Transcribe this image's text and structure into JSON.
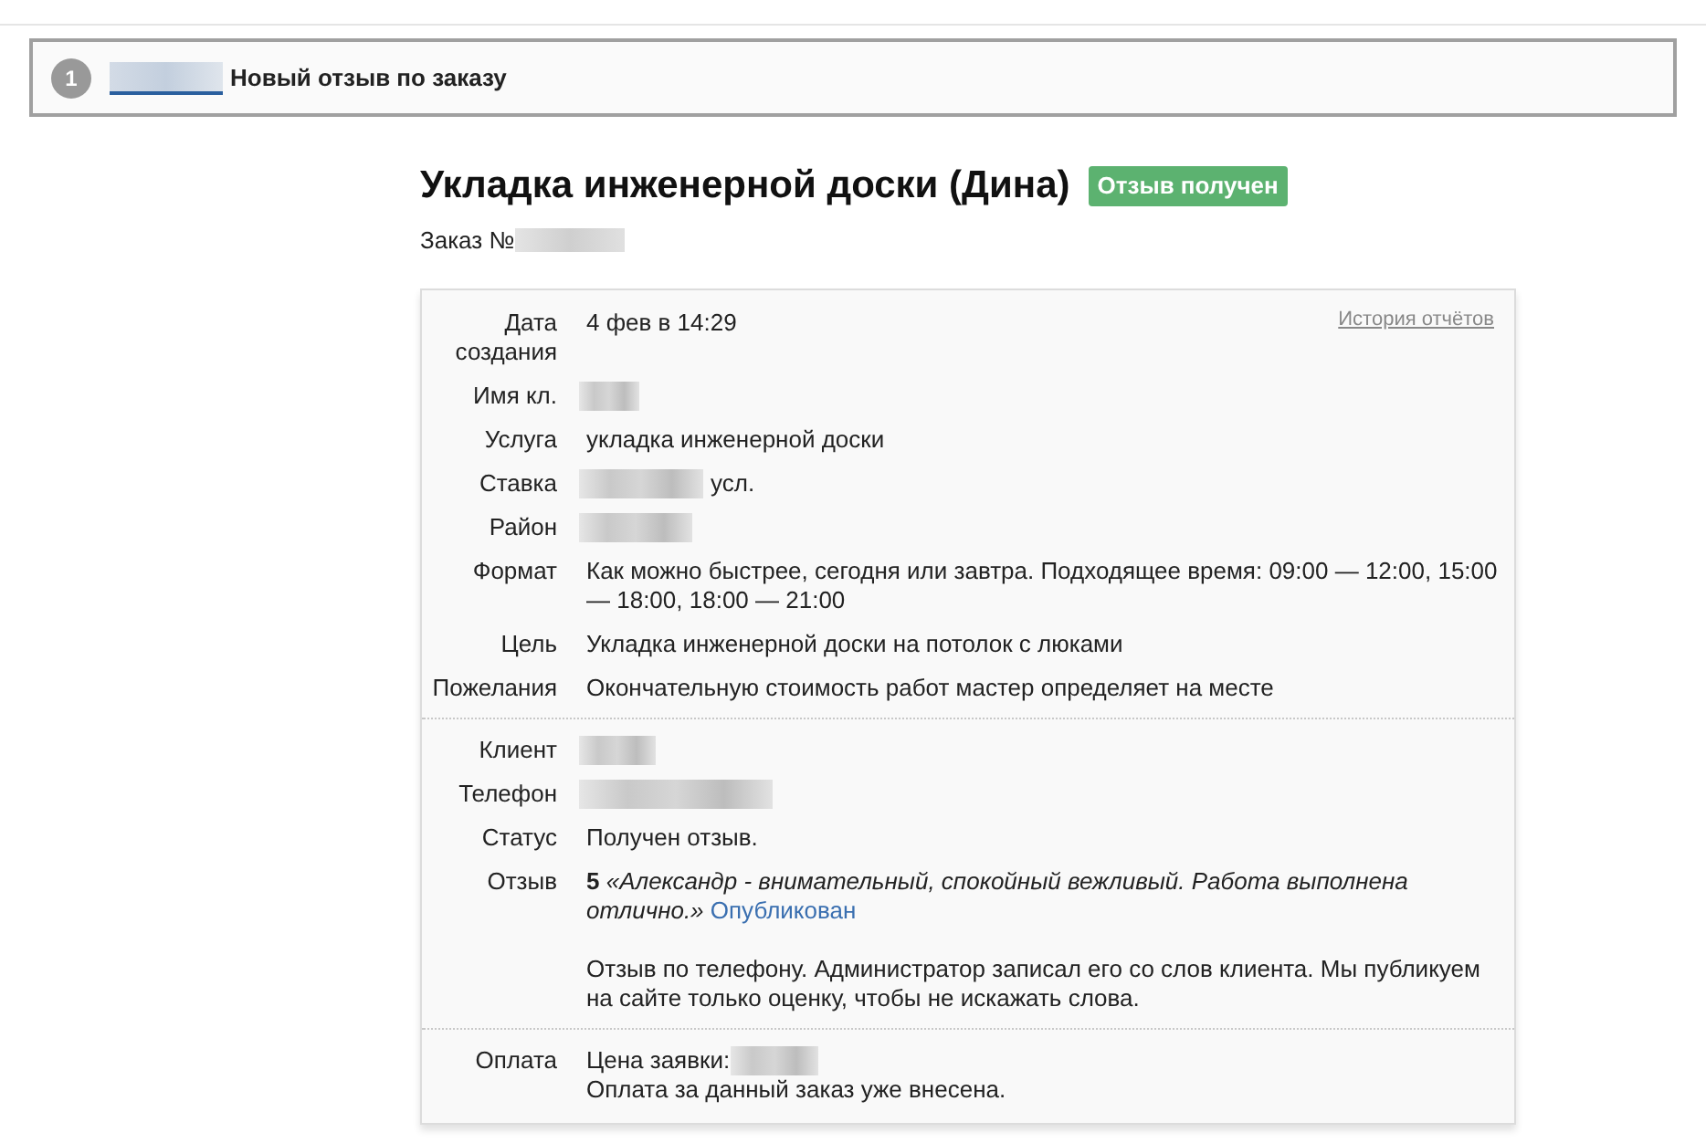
{
  "notification": {
    "step": "1",
    "title": "Новый отзыв по заказу"
  },
  "order": {
    "title": "Укладка инженерной доски (Дина)",
    "badge": "Отзыв получен",
    "number_label": "Заказ №"
  },
  "report_link": "История отчётов",
  "sections": [
    [
      {
        "kind": "text",
        "label": "Дата создания",
        "value": "4 фев в 14:29"
      },
      {
        "kind": "redacted",
        "label": "Имя кл."
      },
      {
        "kind": "text",
        "label": "Услуга",
        "value": "укладка инженерной доски"
      },
      {
        "kind": "redacted",
        "label": "Ставка",
        "suffix": "усл."
      },
      {
        "kind": "redacted",
        "label": "Район"
      },
      {
        "kind": "text",
        "label": "Формат",
        "value": "Как можно быстрее, сегодня или завтра. Подходящее время: 09:00 — 12:00, 15:00 — 18:00, 18:00 — 21:00"
      },
      {
        "kind": "text",
        "label": "Цель",
        "value": "Укладка инженерной доски на потолок с люками"
      },
      {
        "kind": "text",
        "label": "Пожелания",
        "value": "Окончательную стоимость работ мастер определяет на месте"
      }
    ],
    [
      {
        "kind": "redacted",
        "label": "Клиент"
      },
      {
        "kind": "redacted",
        "label": "Телефон"
      },
      {
        "kind": "text",
        "label": "Статус",
        "value": "Получен отзыв."
      },
      {
        "kind": "review",
        "label": "Отзыв",
        "rating": "5",
        "quote": "«Александр - внимательный, спокойный вежливый. Работа выполнена отлично.»",
        "link": "Опубликован",
        "note": "Отзыв по телефону. Администратор записал его со слов клиента. Мы публикуем на сайте только оценку, чтобы не искажать слова."
      }
    ],
    [
      {
        "kind": "payment",
        "label": "Оплата",
        "price_label": "Цена заявки:",
        "note": "Оплата за данный заказ уже внесена."
      }
    ]
  ]
}
